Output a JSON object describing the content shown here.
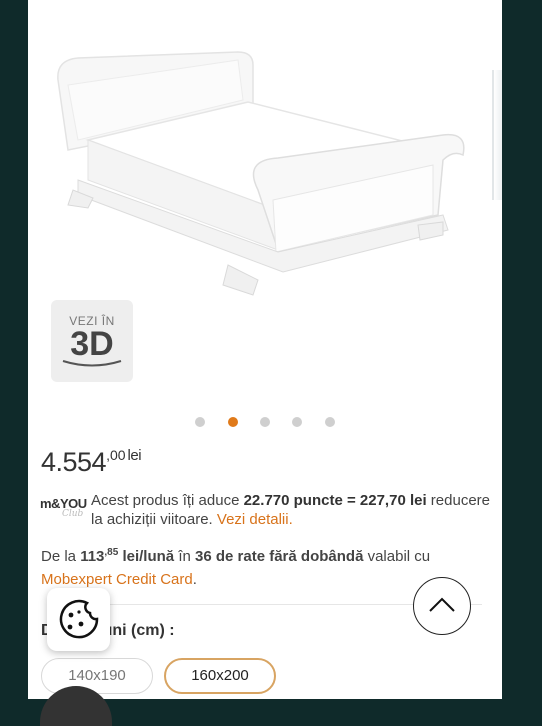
{
  "gallery": {
    "product_image_alt": "bed-product-image",
    "view3d": {
      "line1": "VEZI ÎN",
      "line2": "3D"
    },
    "dots_count": 5,
    "active_dot": 1
  },
  "price": {
    "integer": "4.554",
    "decimals": ",00",
    "currency": "lei"
  },
  "loyalty": {
    "logo_text": "m&YOU",
    "logo_sub": "Club",
    "text_before": "Acest produs îți aduce ",
    "points": "22.770 puncte = 227,70 lei",
    "text_after": " reducere la achiziții viitoare. ",
    "link": "Vezi detalii."
  },
  "installment": {
    "prefix": "De la ",
    "amount_int": "113",
    "amount_dec": ",85",
    "unit": " lei/lună",
    "mid": " în ",
    "count": "36 de rate fără dobândă",
    "suffix": " valabil cu ",
    "card": "Mobexpert Credit Card",
    "end": "."
  },
  "dimensions": {
    "title_visible_start": "D",
    "title_visible_end": "uni (cm) :",
    "options": [
      "140x190",
      "160x200"
    ],
    "selected": "160x200"
  },
  "colors": {
    "accent": "#e07a1a",
    "selected_border": "#d8a462",
    "background": "#0f2a2a"
  },
  "icons": {
    "scroll_top": "chevron-up-icon",
    "cookie": "cookie-icon"
  }
}
